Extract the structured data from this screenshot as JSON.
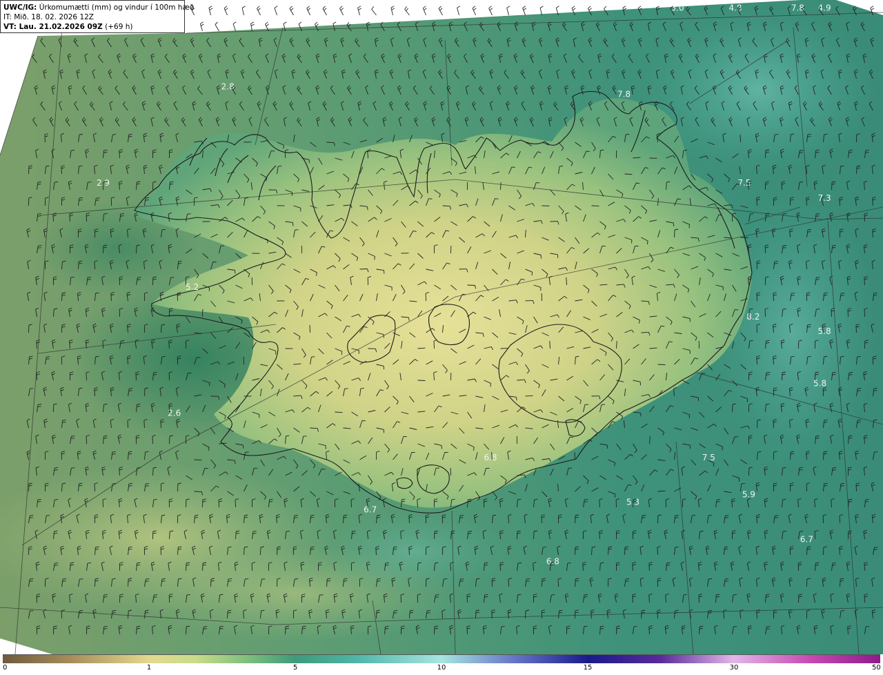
{
  "header": {
    "product": "UWC/IG:",
    "title": "Úrkomumætti (mm) og vindur í 100m hæð",
    "initial_time": "IT: Mið. 18. 02. 2026 12Z",
    "valid_label": "VT: Lau. 21.02.2026 09Z",
    "valid_offset": "(+69 h)"
  },
  "map_labels": [
    {
      "text": "5.0",
      "lon": -13.2,
      "lat": 67.75
    },
    {
      "text": "7.8",
      "lon": -10.5,
      "lat": 67.85
    },
    {
      "text": "4.9",
      "lon": -9.9,
      "lat": 67.45
    },
    {
      "text": "4.8",
      "lon": -11.9,
      "lat": 67.2
    },
    {
      "text": "2.8",
      "lon": -23.3,
      "lat": 66.6
    },
    {
      "text": "7.8",
      "lon": -14.4,
      "lat": 66.55
    },
    {
      "text": "2.9",
      "lon": -26.1,
      "lat": 65.95
    },
    {
      "text": "7.5",
      "lon": -11.7,
      "lat": 65.95
    },
    {
      "text": "7.3",
      "lon": -9.9,
      "lat": 65.85
    },
    {
      "text": "5.2",
      "lon": -24.1,
      "lat": 65.25
    },
    {
      "text": "8.2",
      "lon": -11.5,
      "lat": 65.05
    },
    {
      "text": "5.8",
      "lon": -9.9,
      "lat": 64.95
    },
    {
      "text": "5.8",
      "lon": -10.0,
      "lat": 64.6
    },
    {
      "text": "2.6",
      "lon": -24.5,
      "lat": 64.4
    },
    {
      "text": "6.8",
      "lon": -17.4,
      "lat": 64.1
    },
    {
      "text": "7.5",
      "lon": -12.5,
      "lat": 64.1
    },
    {
      "text": "5.9",
      "lon": -11.6,
      "lat": 63.85
    },
    {
      "text": "6.7",
      "lon": -20.1,
      "lat": 63.75
    },
    {
      "text": "5.3",
      "lon": -14.2,
      "lat": 63.8
    },
    {
      "text": "6.7",
      "lon": -10.3,
      "lat": 63.55
    },
    {
      "text": "6.8",
      "lon": -16.0,
      "lat": 63.4
    }
  ],
  "colors": {
    "dry_brown": "#6e5a3e",
    "low_yellow": "#e3d98f",
    "mid_green": "#3f9a7a",
    "teal": "#4fb3a6",
    "coast_line": "#1a1a1a",
    "wind_barb": "#222222"
  },
  "colorbar": {
    "ticks": [
      "0",
      "1",
      "5",
      "10",
      "15",
      "30",
      "50"
    ]
  }
}
